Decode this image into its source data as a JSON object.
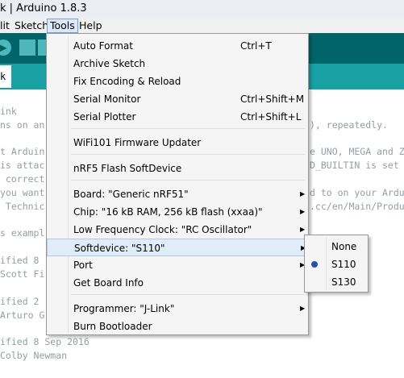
{
  "window": {
    "title": "k | Arduino 1.8.3"
  },
  "menubar": {
    "edit": "lit",
    "sketch": "Sketch",
    "tools": "Tools",
    "help": "Help"
  },
  "tab": {
    "label": "k"
  },
  "editor_lines": [
    "ink",
    "ns on an",
    "t Arduin",
    "is attac",
    " correct",
    "you want",
    " Technic",
    "s exampl",
    "ified 8",
    "Scott Fi",
    "ified 2",
    "Arturo G",
    "ified 8 Sep 2016",
    "Colby Newman"
  ],
  "editor_right": [
    "), repeatedly.",
    "e UNO, MEGA and ZE",
    "D_BUILTIN is set t",
    "d to on your Ardui",
    ".cc/en/Main/Produc"
  ],
  "tools_menu": {
    "items": [
      {
        "label": "Auto Format",
        "shortcut": "Ctrl+T"
      },
      {
        "label": "Archive Sketch",
        "shortcut": ""
      },
      {
        "label": "Fix Encoding & Reload",
        "shortcut": ""
      },
      {
        "label": "Serial Monitor",
        "shortcut": "Ctrl+Shift+M"
      },
      {
        "label": "Serial Plotter",
        "shortcut": "Ctrl+Shift+L"
      },
      {
        "label": "WiFi101 Firmware Updater",
        "shortcut": ""
      },
      {
        "label": "nRF5 Flash SoftDevice",
        "shortcut": ""
      },
      {
        "label": "Board: \"Generic nRF51\"",
        "shortcut": ""
      },
      {
        "label": "Chip: \"16 kB RAM, 256 kB flash (xxaa)\"",
        "shortcut": ""
      },
      {
        "label": "Low Frequency Clock: \"RC Oscillator\"",
        "shortcut": ""
      },
      {
        "label": "Softdevice: \"S110\"",
        "shortcut": ""
      },
      {
        "label": "Port",
        "shortcut": ""
      },
      {
        "label": "Get Board Info",
        "shortcut": ""
      },
      {
        "label": "Programmer: \"J-Link\"",
        "shortcut": ""
      },
      {
        "label": "Burn Bootloader",
        "shortcut": ""
      }
    ]
  },
  "softdevice_submenu": {
    "options": [
      "None",
      "S110",
      "S130"
    ],
    "selected": "S110"
  },
  "colors": {
    "toolbar": "#006468",
    "tabstrip": "#17a1a5",
    "highlight": "#e1ecf9"
  }
}
